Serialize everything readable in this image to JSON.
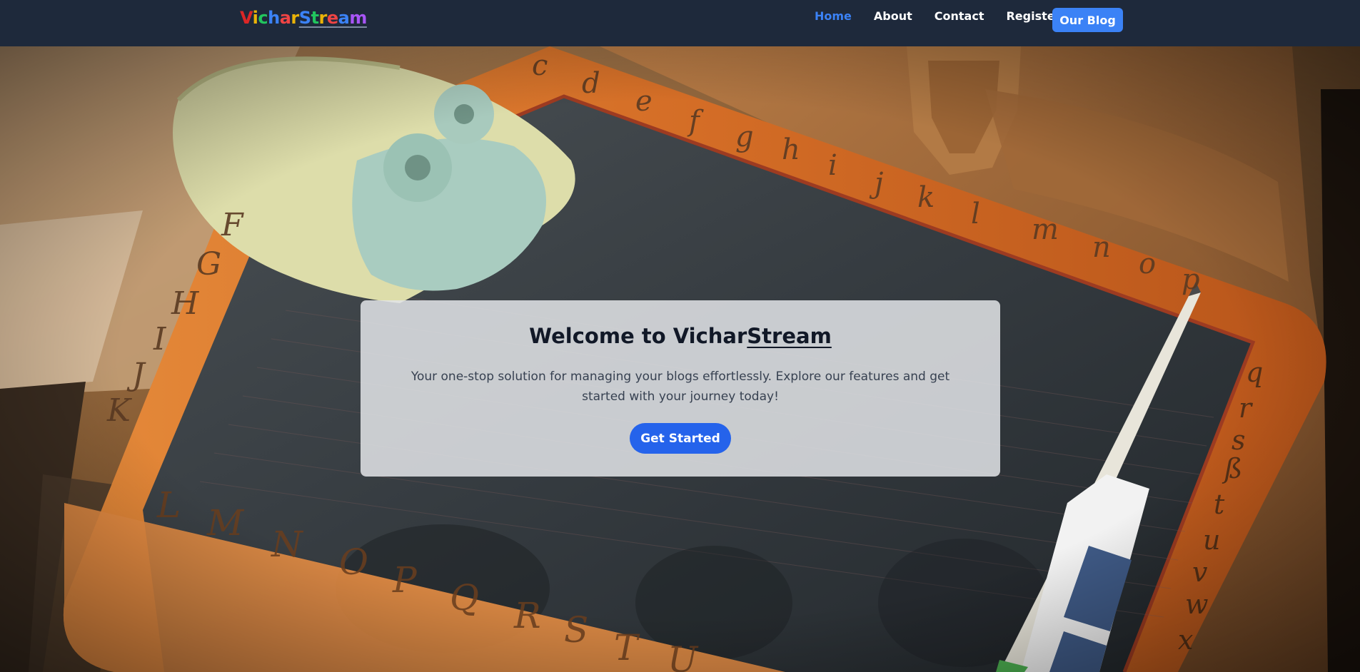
{
  "brand": {
    "part1": "Vichar",
    "part2": "Stream",
    "letter_colors": [
      "#dc2626",
      "#eab308",
      "#22c55e",
      "#3b82f6",
      "#ef4444",
      "#eab308",
      "#3b82f6",
      "#22c55e",
      "#eab308",
      "#ef4444",
      "#3b82f6",
      "#a855f7"
    ]
  },
  "nav": {
    "links": [
      {
        "label": "Home",
        "active": true
      },
      {
        "label": "About",
        "active": false
      },
      {
        "label": "Contact",
        "active": false
      },
      {
        "label": "Register",
        "active": false
      }
    ],
    "cta_label": "Our Blog"
  },
  "hero": {
    "title_prefix": "Welcome to Vichar",
    "title_underlined": "Stream",
    "description": "Your one-stop solution for managing your blogs effortlessly. Explore our features and get started with your journey today!",
    "button_label": "Get Started",
    "slate_top_letters": [
      "c",
      "d",
      "e",
      "f",
      "g",
      "h",
      "i",
      "j",
      "k",
      "l",
      "m",
      "n",
      "o",
      "p"
    ],
    "slate_left_letters": [
      "F",
      "G",
      "H",
      "I",
      "J",
      "K"
    ],
    "slate_bottom_letters": [
      "L",
      "M",
      "N",
      "O",
      "P",
      "Q",
      "R",
      "S",
      "T",
      "U"
    ],
    "slate_right_letters": [
      "q",
      "r",
      "s",
      "ß",
      "t",
      "u",
      "v",
      "w",
      "x"
    ]
  },
  "colors": {
    "navbar_bg": "#1e293b",
    "accent": "#3b82f6",
    "button": "#2563eb",
    "card_bg": "#e2e4e8"
  }
}
